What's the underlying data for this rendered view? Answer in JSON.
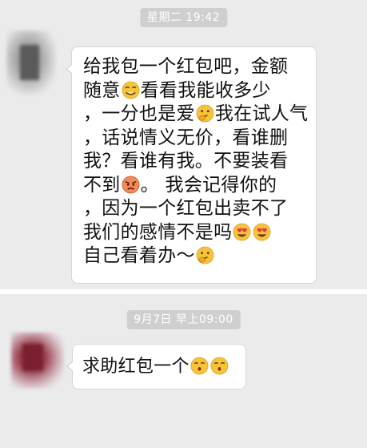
{
  "messages": [
    {
      "timestamp": "星期二 19:42",
      "lines": [
        {
          "parts": [
            "给我包一个红包吧，金额"
          ]
        },
        {
          "parts": [
            "随意",
            "看看我能收多少"
          ]
        },
        {
          "parts": [
            "，一分也是爱",
            "我在试人气"
          ]
        },
        {
          "parts": [
            "，话说情义无价，看谁删"
          ]
        },
        {
          "parts": [
            "我？看谁有我。不要装看"
          ]
        },
        {
          "parts": [
            "不到",
            "。   我会记得你的"
          ]
        },
        {
          "parts": [
            "，因为一个红包出卖不了"
          ]
        },
        {
          "parts": [
            "我们的感情不是吗",
            ""
          ]
        },
        {
          "parts": [
            "自己看着办～",
            ""
          ]
        }
      ],
      "emojis": [
        "cunning-emoji",
        "thinking-hand-emoji",
        "angry-emoji",
        "heart-eyes-emoji",
        "heart-eyes-emoji",
        "thinking-hand-emoji"
      ]
    },
    {
      "timestamp": "9月7日 早上09:00",
      "lines": [
        {
          "parts": [
            "求助红包一个",
            ""
          ]
        }
      ],
      "emojis": [
        "kissing-emoji",
        "kissing-emoji"
      ]
    }
  ],
  "colors": {
    "chat_background": "#ebebeb",
    "bubble": "#ffffff",
    "timestamp_badge": "#cfcfcf",
    "emoji_yellow": "#f7c33a"
  }
}
